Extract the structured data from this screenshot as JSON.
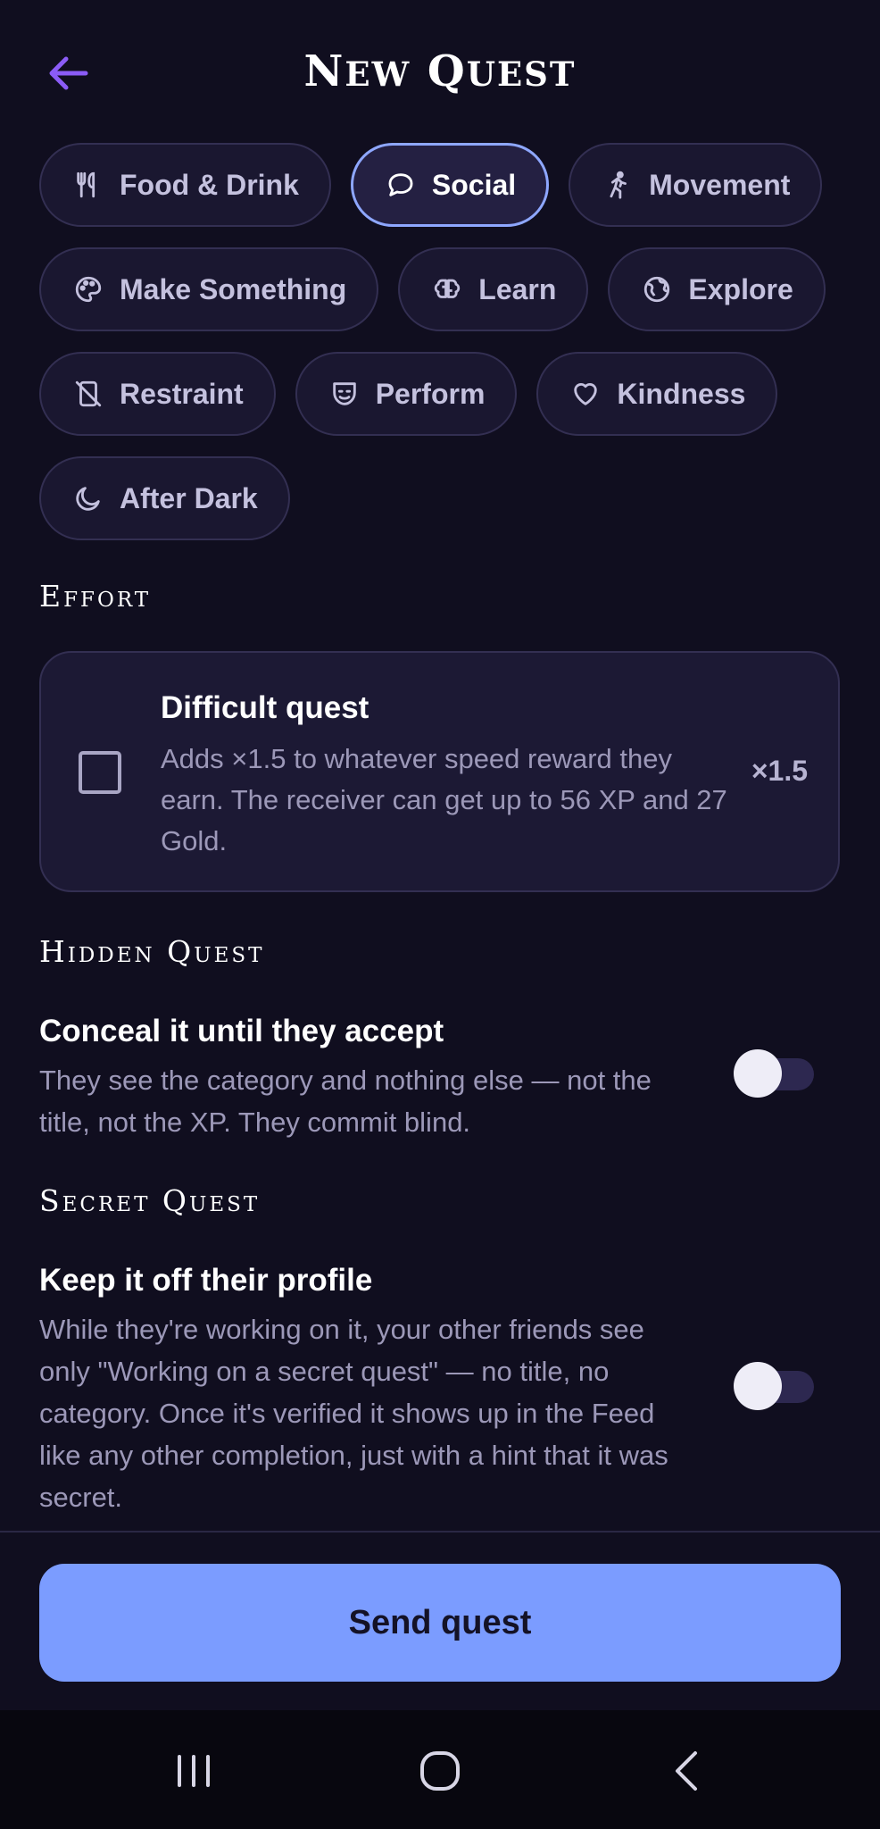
{
  "header": {
    "title_first": "N",
    "title_first_rest": "EW",
    "title_second": "Q",
    "title_second_rest": "UEST"
  },
  "categories": [
    {
      "label": "Food & Drink",
      "icon": "utensils-icon",
      "selected": false
    },
    {
      "label": "Social",
      "icon": "chat-bubble-icon",
      "selected": true
    },
    {
      "label": "Movement",
      "icon": "running-icon",
      "selected": false
    },
    {
      "label": "Make Something",
      "icon": "palette-icon",
      "selected": false
    },
    {
      "label": "Learn",
      "icon": "brain-icon",
      "selected": false
    },
    {
      "label": "Explore",
      "icon": "globe-icon",
      "selected": false
    },
    {
      "label": "Restraint",
      "icon": "phone-off-icon",
      "selected": false
    },
    {
      "label": "Perform",
      "icon": "theater-mask-icon",
      "selected": false
    },
    {
      "label": "Kindness",
      "icon": "heart-icon",
      "selected": false
    },
    {
      "label": "After Dark",
      "icon": "moon-icon",
      "selected": false
    }
  ],
  "effort": {
    "section_label": "Effort",
    "title": "Difficult quest",
    "description": "Adds ×1.5 to whatever speed reward they earn. The receiver can get up to 56 XP and 27 Gold.",
    "multiplier": "×1.5",
    "checked": false
  },
  "hidden": {
    "section_label": "Hidden Quest",
    "title": "Conceal it until they accept",
    "description": "They see the category and nothing else — not the title, not the XP. They commit blind.",
    "enabled": false
  },
  "secret": {
    "section_label": "Secret Quest",
    "title": "Keep it off their profile",
    "description": "While they're working on it, your other friends see only \"Working on a secret quest\" — no title, no category. Once it's verified it shows up in the Feed like any other completion, just with a hint that it was secret.",
    "enabled": false
  },
  "footer": {
    "send_label": "Send quest"
  },
  "colors": {
    "background": "#100e1f",
    "accent": "#7b9cff",
    "back_arrow": "#8b5cf6"
  }
}
